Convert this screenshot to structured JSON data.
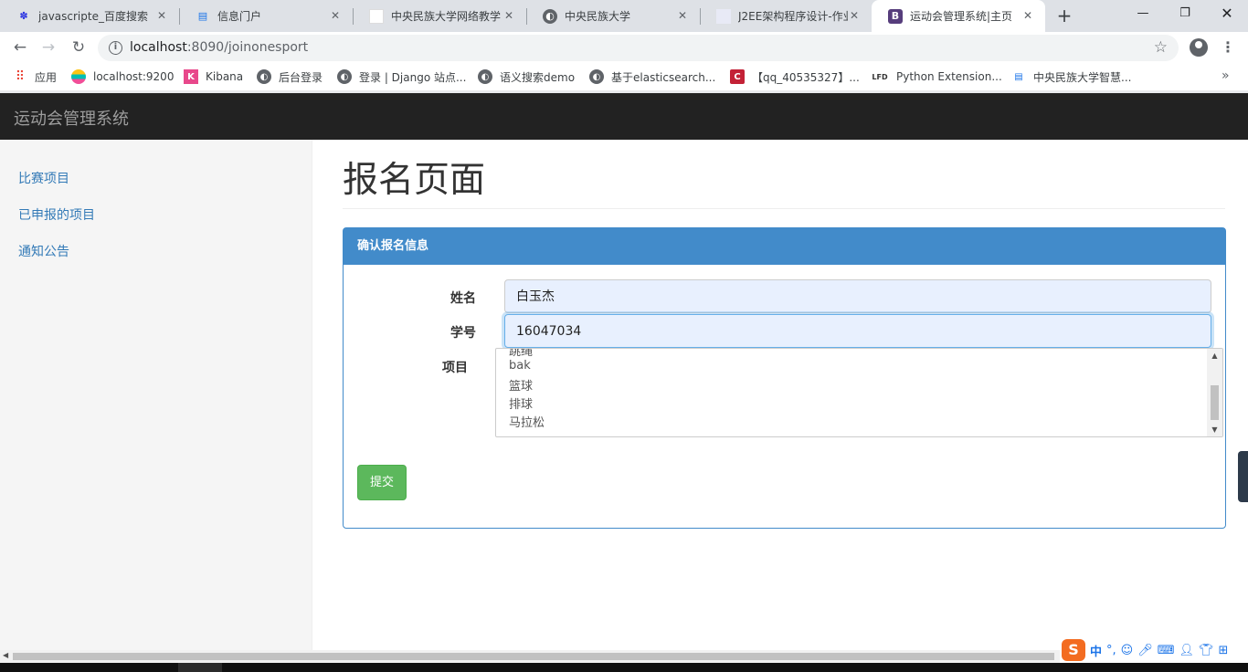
{
  "browser": {
    "tabs": [
      {
        "title": "javascripte_百度搜索",
        "icon": "baidu-paw-icon"
      },
      {
        "title": "信息门户",
        "icon": "message-icon"
      },
      {
        "title": "中央民族大学网络教学",
        "icon": "blank-page-icon"
      },
      {
        "title": "中央民族大学",
        "icon": "globe-icon"
      },
      {
        "title": "J2EE架构程序设计-作业",
        "icon": "page-icon"
      },
      {
        "title": "运动会管理系统|主页",
        "icon": "bootstrap-icon",
        "active": true
      }
    ],
    "url_host": "localhost",
    "url_path": ":8090/joinonesport",
    "bookmarks": [
      {
        "label": "应用",
        "icon": "apps-grid-icon"
      },
      {
        "label": "localhost:9200",
        "icon": "elastic-icon"
      },
      {
        "label": "Kibana",
        "icon": "kibana-icon"
      },
      {
        "label": "后台登录",
        "icon": "globe-icon"
      },
      {
        "label": "登录 | Django 站点...",
        "icon": "globe-icon"
      },
      {
        "label": "语义搜索demo",
        "icon": "globe-icon"
      },
      {
        "label": "基于elasticsearch...",
        "icon": "globe-icon"
      },
      {
        "label": "【qq_40535327】...",
        "icon": "csdn-icon"
      },
      {
        "label": "Python Extension...",
        "icon": "lfd-icon"
      },
      {
        "label": "中央民族大学智慧...",
        "icon": "message-icon"
      }
    ],
    "lfd_badge": "LFD",
    "csdn_badge": "C",
    "bootstrap_badge": "B"
  },
  "app": {
    "brand": "运动会管理系统",
    "sidebar": [
      {
        "label": "比赛项目"
      },
      {
        "label": "已申报的项目"
      },
      {
        "label": "通知公告"
      }
    ],
    "page_title": "报名页面",
    "panel_title": "确认报名信息",
    "form": {
      "name_label": "姓名",
      "name_value": "白玉杰",
      "id_label": "学号",
      "id_value": "16047034",
      "project_label": "项目",
      "project_options": [
        "跳绳",
        "bak",
        "篮球",
        "排球",
        "马拉松"
      ]
    },
    "submit_label": "提交"
  },
  "ime": {
    "mode": "中",
    "punct": "°,"
  },
  "colors": {
    "navbar": "#222222",
    "panel_primary": "#428bca",
    "link": "#337ab7",
    "submit": "#5cb85c"
  }
}
